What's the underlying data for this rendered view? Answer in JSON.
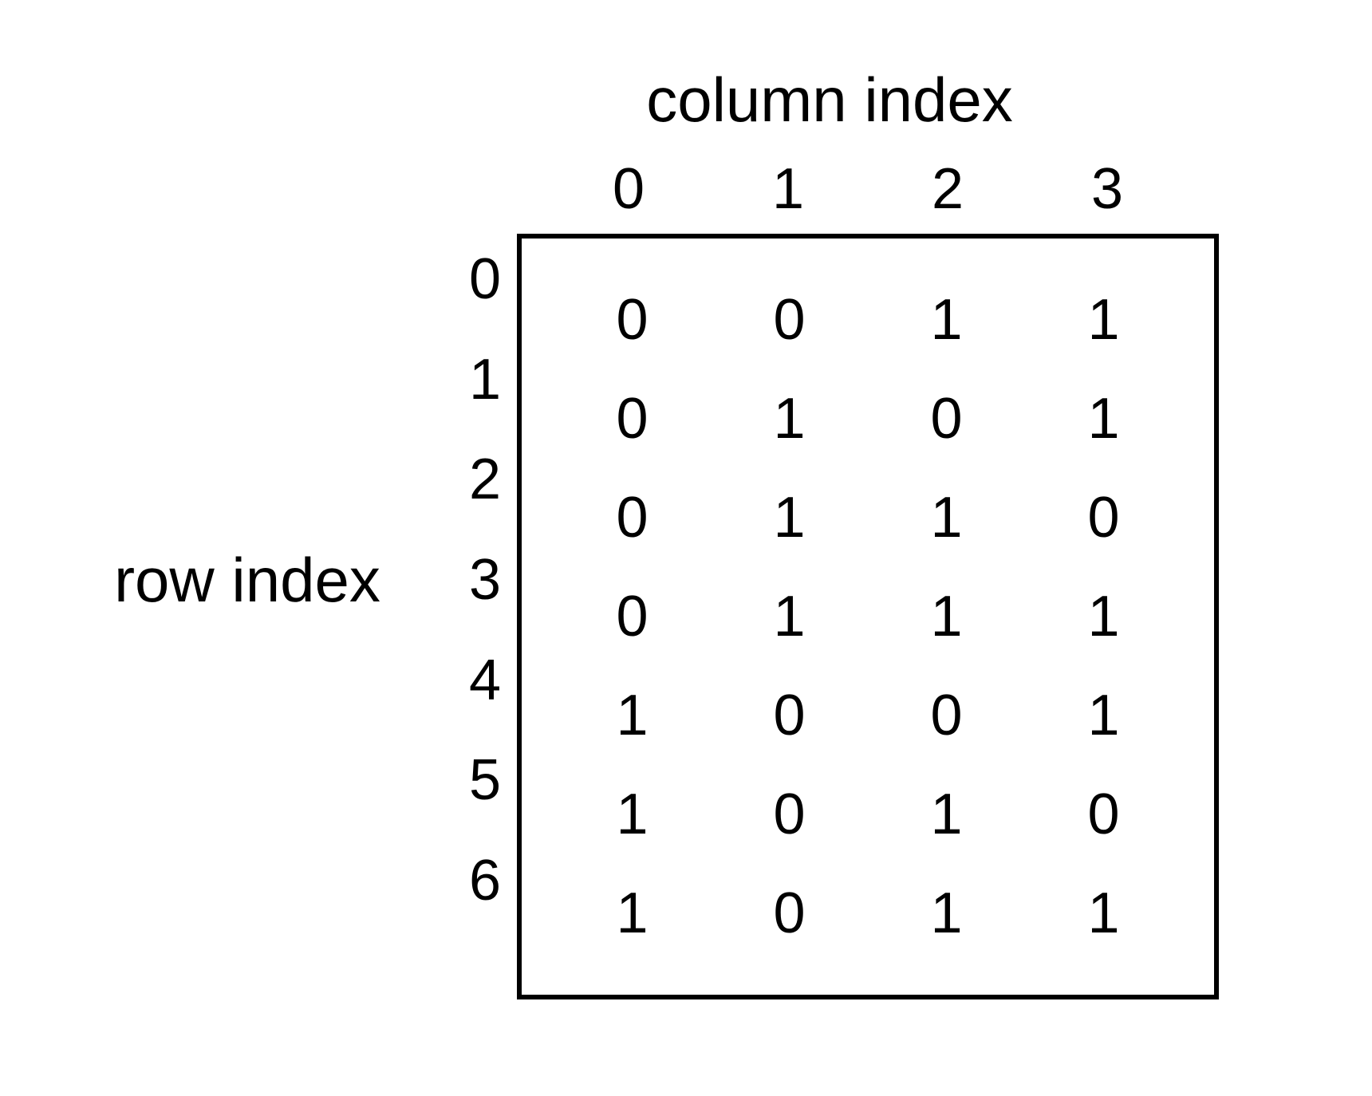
{
  "labels": {
    "column_header": "column index",
    "row_header": "row index"
  },
  "column_indices": [
    "0",
    "1",
    "2",
    "3"
  ],
  "row_indices": [
    "0",
    "1",
    "2",
    "3",
    "4",
    "5",
    "6"
  ],
  "matrix": [
    [
      "0",
      "0",
      "1",
      "1"
    ],
    [
      "0",
      "1",
      "0",
      "1"
    ],
    [
      "0",
      "1",
      "1",
      "0"
    ],
    [
      "0",
      "1",
      "1",
      "1"
    ],
    [
      "1",
      "0",
      "0",
      "1"
    ],
    [
      "1",
      "0",
      "1",
      "0"
    ],
    [
      "1",
      "0",
      "1",
      "1"
    ]
  ],
  "chart_data": {
    "type": "table",
    "title": "",
    "xlabel": "column index",
    "ylabel": "row index",
    "columns": [
      0,
      1,
      2,
      3
    ],
    "rows": [
      0,
      1,
      2,
      3,
      4,
      5,
      6
    ],
    "values": [
      [
        0,
        0,
        1,
        1
      ],
      [
        0,
        1,
        0,
        1
      ],
      [
        0,
        1,
        1,
        0
      ],
      [
        0,
        1,
        1,
        1
      ],
      [
        1,
        0,
        0,
        1
      ],
      [
        1,
        0,
        1,
        0
      ],
      [
        1,
        0,
        1,
        1
      ]
    ]
  }
}
